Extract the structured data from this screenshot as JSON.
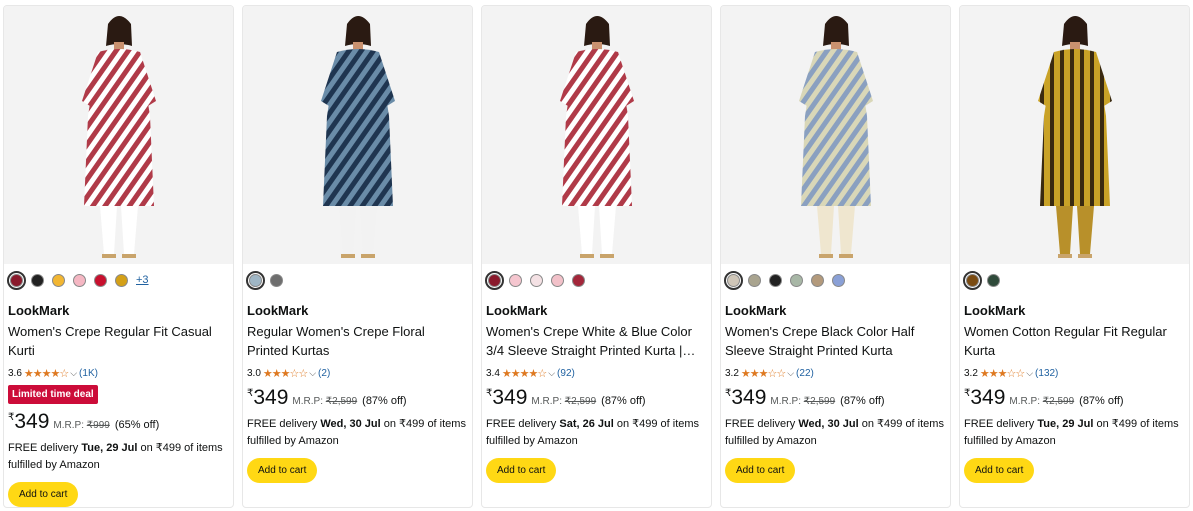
{
  "products": [
    {
      "brand": "LookMark",
      "title": "Women's Crepe Regular Fit Casual Kurti",
      "rating": "3.6",
      "stars": "★★★★☆",
      "review_count": "(1K)",
      "deal": "Limited time deal",
      "currency": "₹",
      "price": "349",
      "mrp_label": "M.R.P:",
      "mrp": "₹999",
      "discount": "(65% off)",
      "delivery_prefix": "FREE delivery ",
      "delivery_date": "Tue, 29 Jul",
      "delivery_suffix": " on ₹499 of items fulfilled by Amazon",
      "button": "Add to cart",
      "more_colors": "+3",
      "swatches": [
        "#8a1a2c",
        "#222222",
        "#f2b632",
        "#f5b7c3",
        "#c8102e",
        "#d4a017"
      ],
      "image_colors": {
        "dress": "#b03a48",
        "stripe": "#ffffff",
        "pants": "#ffffff"
      }
    },
    {
      "brand": "LookMark",
      "title": "Regular Women's Crepe Floral Printed Kurtas",
      "rating": "3.0",
      "stars": "★★★☆☆",
      "review_count": "(2)",
      "deal": "",
      "currency": "₹",
      "price": "349",
      "mrp_label": "M.R.P:",
      "mrp": "₹2,599",
      "discount": "(87% off)",
      "delivery_prefix": "FREE delivery ",
      "delivery_date": "Wed, 30 Jul",
      "delivery_suffix": " on ₹499 of items fulfilled by Amazon",
      "button": "Add to cart",
      "more_colors": "",
      "swatches": [
        "#9fb6c5",
        "#6e6e6e"
      ],
      "image_colors": {
        "dress": "#6a8ca8",
        "stripe": "#1f3550",
        "pants": "#f2f2f2"
      }
    },
    {
      "brand": "LookMark",
      "title": "Women's Crepe White & Blue Color 3/4 Sleeve Straight Printed Kurta |…",
      "rating": "3.4",
      "stars": "★★★★☆",
      "review_count": "(92)",
      "deal": "",
      "currency": "₹",
      "price": "349",
      "mrp_label": "M.R.P:",
      "mrp": "₹2,599",
      "discount": "(87% off)",
      "delivery_prefix": "FREE delivery ",
      "delivery_date": "Sat, 26 Jul",
      "delivery_suffix": " on ₹499 of items fulfilled by Amazon",
      "button": "Add to cart",
      "more_colors": "",
      "swatches": [
        "#8a1a2c",
        "#f5c6cf",
        "#f4e1e4",
        "#f2c1c9",
        "#a3263a"
      ],
      "image_colors": {
        "dress": "#b03a48",
        "stripe": "#ffffff",
        "pants": "#ffffff"
      }
    },
    {
      "brand": "LookMark",
      "title": "Women's Crepe Black Color Half Sleeve Straight Printed Kurta",
      "rating": "3.2",
      "stars": "★★★☆☆",
      "review_count": "(22)",
      "deal": "",
      "currency": "₹",
      "price": "349",
      "mrp_label": "M.R.P:",
      "mrp": "₹2,599",
      "discount": "(87% off)",
      "delivery_prefix": "FREE delivery ",
      "delivery_date": "Wed, 30 Jul",
      "delivery_suffix": " on ₹499 of items fulfilled by Amazon",
      "button": "Add to cart",
      "more_colors": "",
      "swatches": [
        "#cfc6b8",
        "#a9a48f",
        "#222222",
        "#a8b7a6",
        "#b39a7c",
        "#8aa0d6"
      ],
      "image_colors": {
        "dress": "#d9d7b8",
        "stripe": "#8aa0c0",
        "pants": "#efe6cf"
      }
    },
    {
      "brand": "LookMark",
      "title": "Women Cotton Regular Fit Regular Kurta",
      "rating": "3.2",
      "stars": "★★★☆☆",
      "review_count": "(132)",
      "deal": "",
      "currency": "₹",
      "price": "349",
      "mrp_label": "M.R.P:",
      "mrp": "₹2,599",
      "discount": "(87% off)",
      "delivery_prefix": "FREE delivery ",
      "delivery_date": "Tue, 29 Jul",
      "delivery_suffix": " on ₹499 of items fulfilled by Amazon",
      "button": "Add to cart",
      "more_colors": "",
      "swatches": [
        "#7a4b12",
        "#2f4a3a"
      ],
      "image_colors": {
        "dress": "#c9a227",
        "stripe": "#3a2a10",
        "pants": "#b8902a"
      }
    }
  ]
}
